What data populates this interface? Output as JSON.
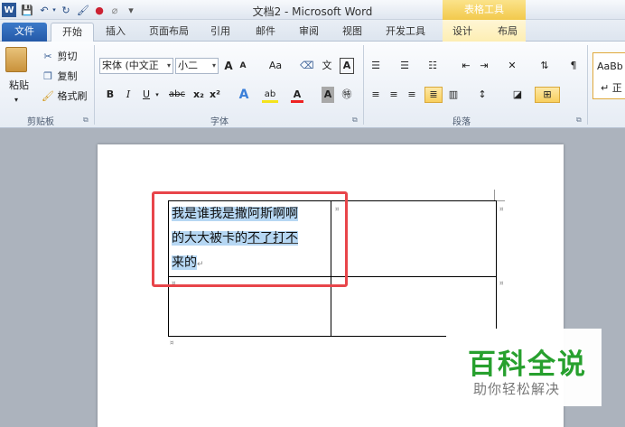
{
  "window": {
    "title": "文档2 - Microsoft Word",
    "table_tools": "表格工具"
  },
  "quick_access": {
    "icons": [
      "word-logo-icon",
      "save-icon",
      "undo-icon",
      "redo-icon",
      "format-painter-icon",
      "color-icon",
      "eraser-icon",
      "customize-icon"
    ]
  },
  "tabs": [
    {
      "label": "文件"
    },
    {
      "label": "开始"
    },
    {
      "label": "插入"
    },
    {
      "label": "页面布局"
    },
    {
      "label": "引用"
    },
    {
      "label": "邮件"
    },
    {
      "label": "审阅"
    },
    {
      "label": "视图"
    },
    {
      "label": "开发工具"
    },
    {
      "label": "设计"
    },
    {
      "label": "布局"
    }
  ],
  "clipboard": {
    "paste": "粘贴",
    "cut": "剪切",
    "copy": "复制",
    "format_painter": "格式刷",
    "group": "剪贴板"
  },
  "font": {
    "name": "宋体 (中文正",
    "size": "小二",
    "grow": "A",
    "shrink": "A",
    "case": "Aa",
    "bold": "B",
    "italic": "I",
    "underline": "U",
    "strike": "abc",
    "subscript": "x₂",
    "superscript": "x²",
    "group": "字体"
  },
  "paragraph": {
    "group": "段落"
  },
  "styles": {
    "sample": "AaBb",
    "normal": "正"
  },
  "document": {
    "line1": "我是谁我是撒阿斯啊啊",
    "line2a": "的大大被卡的",
    "line2b": "不了打不",
    "line3": "来的",
    "paragraph_mark": "↵"
  },
  "watermark": {
    "title": "百科全说",
    "subtitle": "助你轻松解决"
  }
}
